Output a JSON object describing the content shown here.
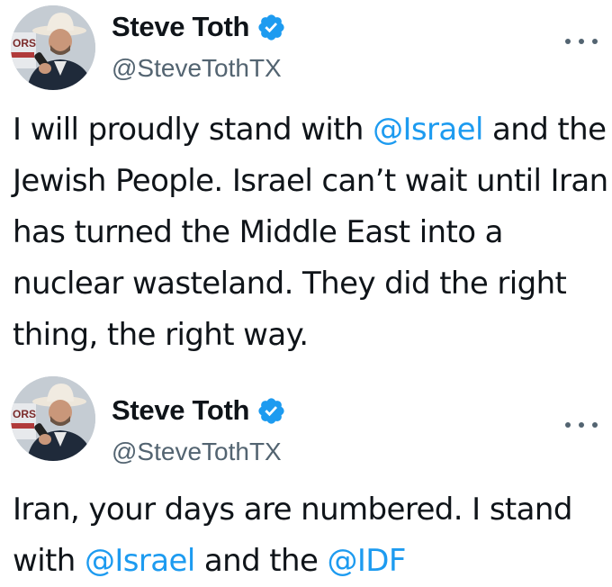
{
  "tweets": [
    {
      "author": {
        "display_name": "Steve Toth",
        "handle": "@SteveTothTX",
        "verified": true,
        "avatar_icon": "profile-photo-cowboy-hat"
      },
      "more_icon": "more-horizontal-icon",
      "text": {
        "parts": [
          "I will proudly stand with ",
          "@Israel",
          " and the Jewish People. Israel can’t wait until Iran has turned the Middle East into a nuclear wasteland. They did the right thing, the right way."
        ]
      }
    },
    {
      "author": {
        "display_name": "Steve Toth",
        "handle": "@SteveTothTX",
        "verified": true,
        "avatar_icon": "profile-photo-cowboy-hat"
      },
      "more_icon": "more-horizontal-icon",
      "text": {
        "parts": [
          "Iran, your days are numbered. I stand with ",
          "@Israel",
          " and the ",
          "@IDF"
        ]
      }
    }
  ],
  "colors": {
    "text": "#0f1419",
    "secondary": "#536471",
    "link": "#1d9bf0",
    "verified_badge": "#1d9bf0",
    "background": "#ffffff"
  }
}
